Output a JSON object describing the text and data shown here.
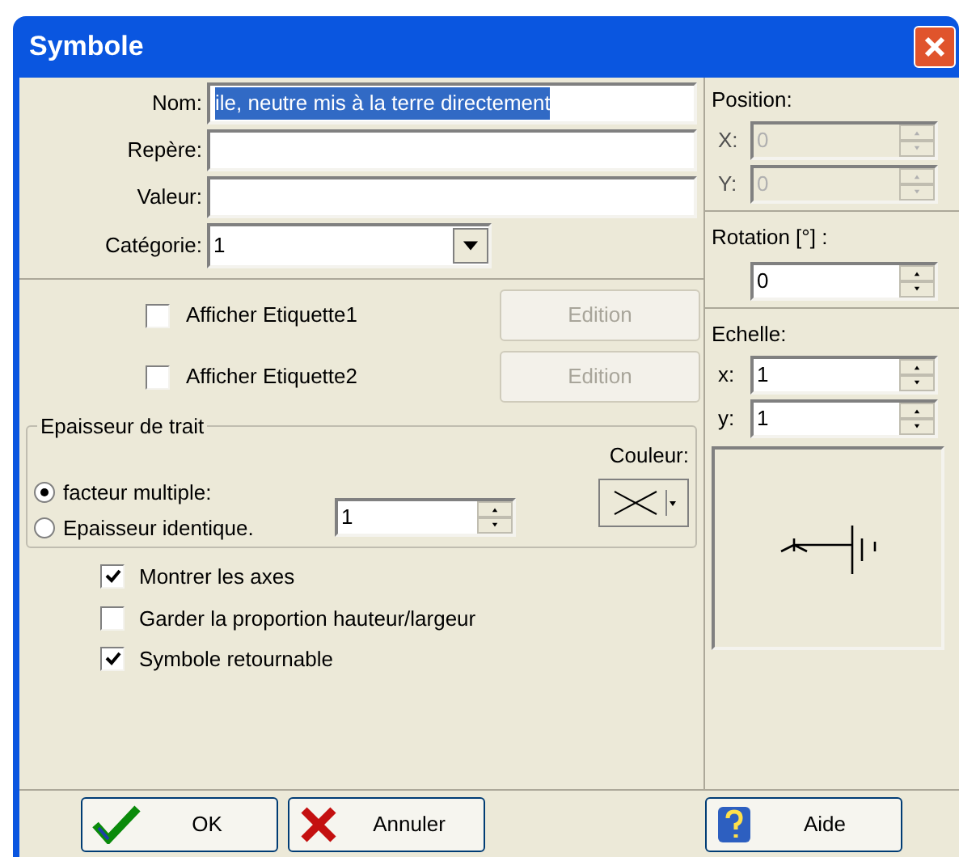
{
  "window": {
    "title": "Symbole"
  },
  "fields": [
    {
      "label": "Nom:",
      "value": "ile, neutre mis à la terre directement",
      "selected": true
    },
    {
      "label": "Repère:"
    },
    {
      "label": "Valeur:"
    }
  ],
  "category": {
    "label": "Catégorie:",
    "value": "1"
  },
  "labels": [
    {
      "label": "Afficher Etiquette1",
      "checked": false,
      "button": "Edition",
      "disabled": true
    },
    {
      "label": "Afficher Etiquette2",
      "checked": false,
      "button": "Edition",
      "disabled": true
    }
  ],
  "line_width": {
    "title": "Epaisseur de trait",
    "options": [
      {
        "label": "facteur multiple:",
        "selected": true
      },
      {
        "label": "Epaisseur identique.",
        "selected": false
      }
    ],
    "factor": "1",
    "color_label": "Couleur:"
  },
  "options": [
    {
      "label": "Montrer les axes",
      "checked": true
    },
    {
      "label": "Garder la proportion hauteur/largeur",
      "checked": false
    },
    {
      "label": "Symbole retournable",
      "checked": true
    }
  ],
  "position": {
    "title": "Position:",
    "disabled": true,
    "coords": [
      {
        "label": "X:",
        "value": "0"
      },
      {
        "label": "Y:",
        "value": "0"
      }
    ]
  },
  "rotation": {
    "title": "Rotation [°] :",
    "value": "0"
  },
  "scale": {
    "title": "Echelle:",
    "coords": [
      {
        "label": "x:",
        "value": "1"
      },
      {
        "label": "y:",
        "value": "1"
      }
    ]
  },
  "buttons": [
    {
      "kind": "ok",
      "label": "OK"
    },
    {
      "kind": "cancel",
      "label": "Annuler"
    },
    {
      "kind": "help",
      "label": "Aide"
    }
  ]
}
